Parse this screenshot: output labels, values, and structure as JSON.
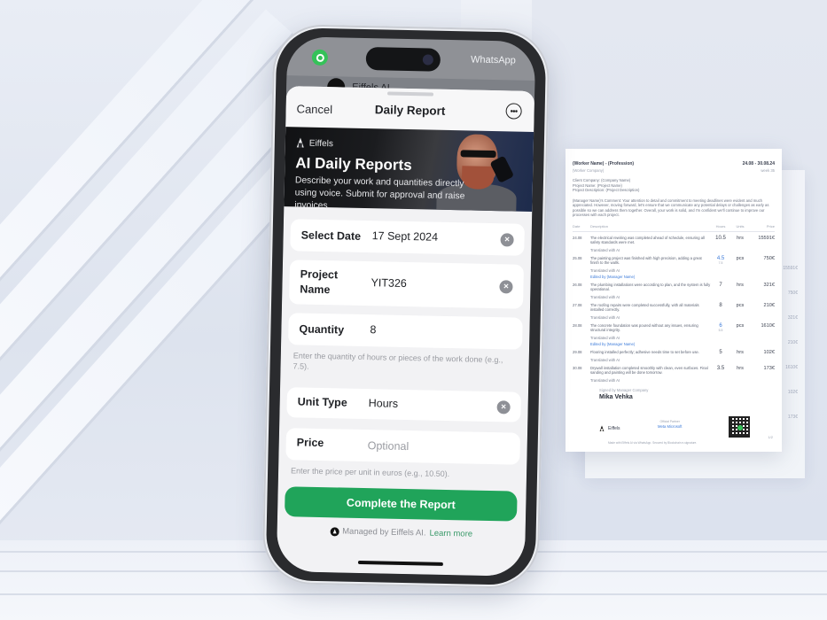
{
  "status_bar": {
    "app_icon": "whatsapp-icon",
    "back_app_label": "WhatsApp",
    "chat_name": "Eiffels AI"
  },
  "nav": {
    "cancel_label": "Cancel",
    "title": "Daily Report",
    "more_icon": "more-circle-icon",
    "more_glyph": "•••"
  },
  "hero": {
    "brand": "Eiffels",
    "title": "AI Daily Reports",
    "subtitle": "Describe your work and quantities directly using voice. Submit for approval and raise invoices."
  },
  "form": {
    "fields": [
      {
        "label": "Select Date",
        "value": "17 Sept 2024",
        "clearable": true
      },
      {
        "label": "Project Name",
        "value": "YIT326",
        "clearable": true
      },
      {
        "label": "Quantity",
        "value": "8",
        "clearable": false,
        "hint": "Enter the quantity of hours or pieces of the work done (e.g., 7.5)."
      },
      {
        "label": "Unit Type",
        "value": "Hours",
        "clearable": true
      },
      {
        "label": "Price",
        "value": "",
        "placeholder": "Optional",
        "clearable": false,
        "hint": "Enter the price per unit in euros (e.g., 10.50)."
      }
    ],
    "clear_glyph": "×"
  },
  "cta": {
    "label": "Complete the Report",
    "color": "#20a45a"
  },
  "footer": {
    "managed_text": "Managed by Eiffels AI.",
    "learn_more": "Learn more"
  },
  "document": {
    "worker": "(Worker Name) - (Profession)",
    "company": "(Worker Company)",
    "date_range": "24.08 - 30.08.24",
    "week": "week 35",
    "client_company": "Client Company: (Company Name)",
    "project_name": "Project Name: (Project Name)",
    "project_description": "Project Description: (Project Description)",
    "manager_comment": "(Manager Name)'s Comment: Your attention to detail and commitment to meeting deadlines were evident and much appreciated. However, moving forward, let's ensure that we communicate any potential delays or challenges as early as possible so we can address them together. Overall, your work is solid, and I'm confident we'll continue to improve our processes with each project.",
    "columns": [
      "Date",
      "Description",
      "Hours",
      "Units",
      "Price"
    ],
    "rows": [
      {
        "date": "24.08",
        "description": "The electrical rewiring was completed ahead of schedule, ensuring all safety standards were met.",
        "qty": "10.5",
        "sub": "",
        "unit": "hrs",
        "price": "15591€",
        "note": "Translated with AI",
        "edited": ""
      },
      {
        "date": "25.08",
        "description": "The painting project was finished with high precision, adding a great finish to the walls.",
        "qty": "4.5",
        "sub": "7.5",
        "unit": "pcs",
        "price": "750€",
        "note": "Translated with AI",
        "edited": "Edited by (Manager Name)"
      },
      {
        "date": "26.08",
        "description": "The plumbing installations were according to plan, and the system is fully operational.",
        "qty": "7",
        "sub": "",
        "unit": "hrs",
        "price": "321€",
        "note": "Translated with AI",
        "edited": ""
      },
      {
        "date": "27.08",
        "description": "The roofing repairs were completed successfully, with all materials installed correctly.",
        "qty": "8",
        "sub": "",
        "unit": "pcs",
        "price": "210€",
        "note": "Translated with AI",
        "edited": ""
      },
      {
        "date": "28.08",
        "description": "The concrete foundation was poured without any issues, ensuring structural integrity.",
        "qty": "6",
        "sub": "5.5",
        "unit": "pcs",
        "price": "1610€",
        "note": "Translated with AI",
        "edited": "Edited by (Manager Name)"
      },
      {
        "date": "29.08",
        "description": "Flooring installed perfectly; adhesive needs time to set before use.",
        "qty": "5",
        "sub": "",
        "unit": "hrs",
        "price": "102€",
        "note": "Translated with AI",
        "edited": ""
      },
      {
        "date": "30.08",
        "description": "Drywall installation completed smoothly with clean, even surfaces. Final sanding and painting will be done tomorrow.",
        "qty": "3.5",
        "sub": "",
        "unit": "hrs",
        "price": "173€",
        "note": "Translated with AI",
        "edited": ""
      }
    ],
    "signed_by": "Signed by Manager Company",
    "signer": "Mika Vehka",
    "footer_brand": "Eiffels",
    "partner_label": "Official Partner",
    "partners": "Meta  Microsoft",
    "made_with": "Made with Eiffels AI via WhatsApp. Secured by Blockchain e-signature.",
    "page": "1/2",
    "back_prices": [
      "15591€",
      "750€",
      "321€",
      "210€",
      "1610€",
      "102€",
      "173€"
    ]
  }
}
